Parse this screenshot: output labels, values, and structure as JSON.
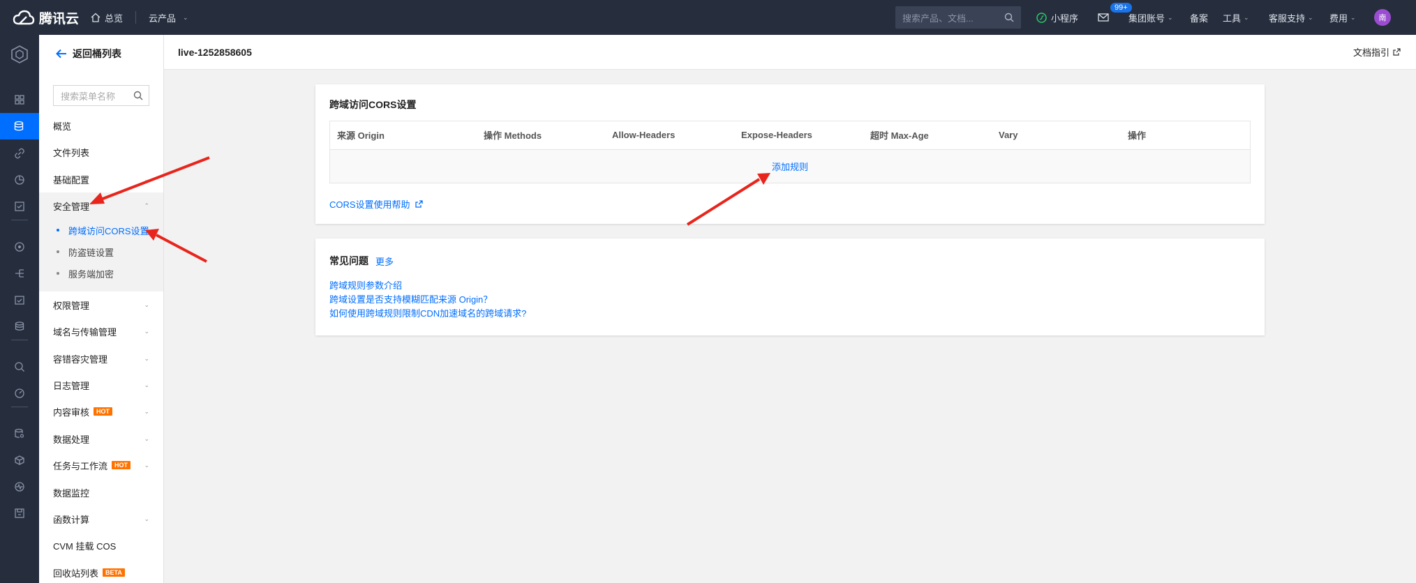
{
  "topbar": {
    "brand": "腾讯云",
    "nav_overview": "总览",
    "nav_products": "云产品",
    "search_placeholder": "搜索产品、文档...",
    "mini_program": "小程序",
    "message_badge": "99+",
    "group_account": "集团账号",
    "beian": "备案",
    "tools": "工具",
    "support": "客服支持",
    "billing": "费用",
    "avatar_text": "南"
  },
  "sidebar": {
    "back_label": "返回桶列表",
    "search_placeholder": "搜索菜单名称",
    "items": {
      "overview": "概览",
      "file_list": "文件列表",
      "basic_config": "基础配置",
      "security": "安全管理",
      "permission": "权限管理",
      "domain": "域名与传输管理",
      "disaster": "容错容灾管理",
      "log": "日志管理",
      "content_review": "内容审核",
      "data_processing": "数据处理",
      "workflow": "任务与工作流",
      "monitoring": "数据监控",
      "function": "函数计算",
      "cvm": "CVM 挂载 COS",
      "recycle": "回收站列表"
    },
    "security_sub": {
      "cors": "跨域访问CORS设置",
      "hotlink": "防盗链设置",
      "encryption": "服务端加密"
    },
    "tags": {
      "hot": "HOT",
      "beta": "BETA"
    }
  },
  "header": {
    "bucket_name": "live-1252858605",
    "doc_guide": "文档指引"
  },
  "cors": {
    "title": "跨域访问CORS设置",
    "columns": [
      "来源 Origin",
      "操作 Methods",
      "Allow-Headers",
      "Expose-Headers",
      "超时 Max-Age",
      "Vary",
      "操作"
    ],
    "add_rule": "添加规则",
    "help_link": "CORS设置使用帮助"
  },
  "faq": {
    "title": "常见问题",
    "more": "更多",
    "links": [
      "跨域规则参数介绍",
      "跨域设置是否支持模糊匹配来源 Origin？",
      "如何使用跨域规则限制CDN加速域名的跨域请求?"
    ]
  },
  "colors": {
    "topbar_bg": "#262e3e",
    "accent": "#006eff",
    "hot_tag": "#ff7200",
    "annotation_arrow": "#e8251c"
  }
}
